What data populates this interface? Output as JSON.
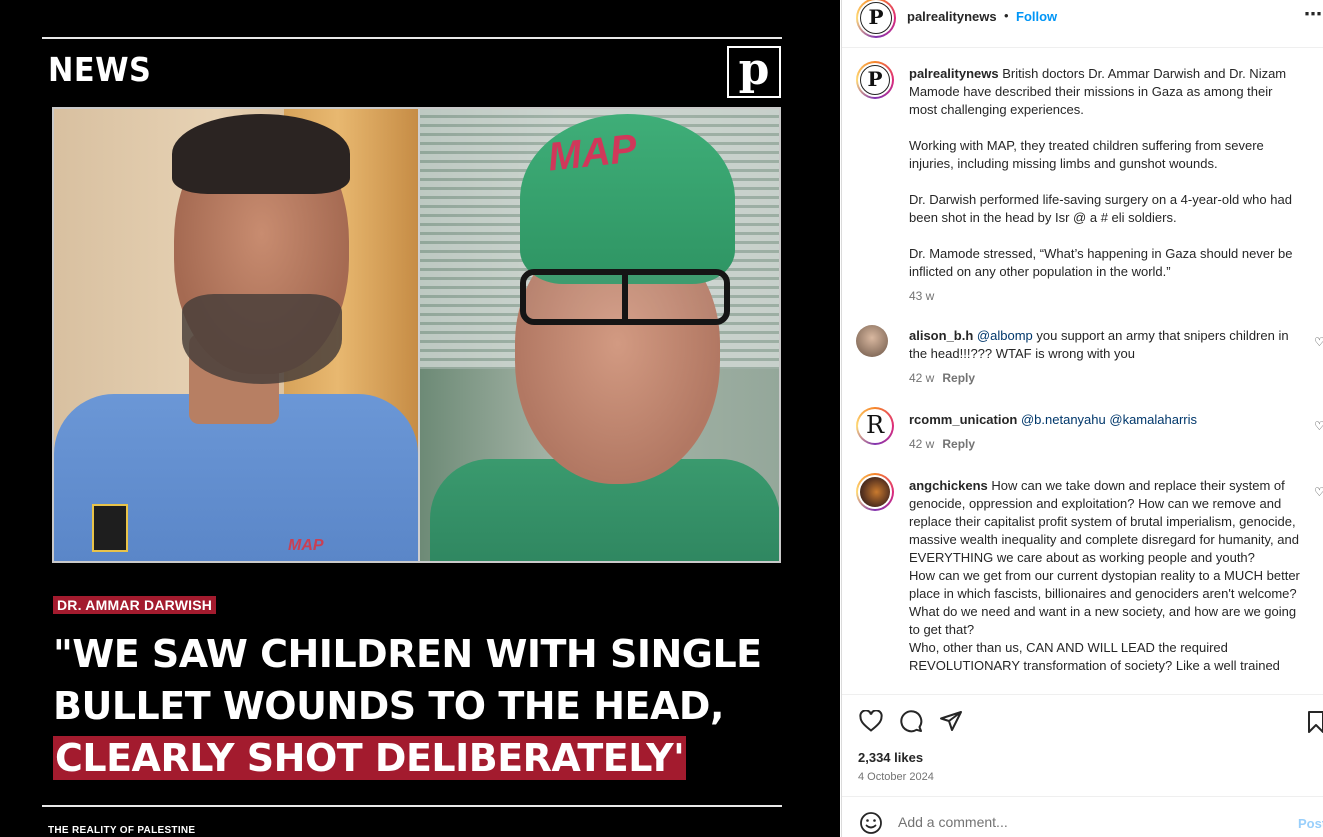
{
  "media": {
    "section_label": "NEWS",
    "brand_logo_letter": "p",
    "left_photo_badge": "MAP",
    "right_photo_cap": "MAP",
    "name_tag": "DR. AMMAR DARWISH",
    "quote_lines": [
      "\"WE SAW CHILDREN WITH SINGLE",
      "BULLET WOUNDS TO THE HEAD,",
      "CLEARLY SHOT DELIBERATELY'"
    ],
    "footer_brand": "THE REALITY OF  PALESTINE"
  },
  "header": {
    "avatar_letter": "P",
    "username": "palrealitynews",
    "separator": "•",
    "follow_label": "Follow",
    "more_icon": "more-horizontal-icon"
  },
  "caption": {
    "username": "palrealitynews",
    "paragraphs": [
      "British doctors Dr. Ammar Darwish and Dr. Nizam Mamode have described their missions in Gaza as among their most challenging experiences.",
      "Working with MAP, they treated children suffering from severe injuries, including missing limbs and gunshot wounds.",
      "Dr. Darwish performed life-saving surgery on a 4-year-old who had been shot in the head by Isr @ a # eli soldiers.",
      "Dr. Mamode stressed, “What’s happening in Gaza should never be inflicted on any other population in the world.”"
    ],
    "time": "43 w"
  },
  "comments": [
    {
      "username": "alison_b.h",
      "mention": "@albomp",
      "text": " you support an army that snipers children in the head!!!??? WTAF is wrong with you",
      "time": "42 w",
      "reply_label": "Reply"
    },
    {
      "username": "rcomm_unication",
      "avatar_letter": "R",
      "mention": "@b.netanyahu",
      "mention2": "@kamalaharris",
      "text": "",
      "time": "42 w",
      "reply_label": "Reply"
    },
    {
      "username": "angchickens",
      "text": " How can we take down and replace their system of genocide, oppression and exploitation? How can we remove and replace their capitalist profit system of brutal imperialism, genocide, massive wealth inequality and complete disregard for humanity, and EVERYTHING we care about as working people and youth?",
      "text2": "How can we get from our current dystopian reality to a MUCH better place in which fascists, billionaires and genociders aren't welcome? What do we need and want in a new society, and how are we going to get that?",
      "text3": "Who, other than us, CAN AND WILL LEAD the required REVOLUTIONARY transformation of society? Like a well trained"
    }
  ],
  "actions": {
    "icons": [
      "heart-icon",
      "comment-icon",
      "share-icon",
      "bookmark-icon"
    ],
    "likes": "2,334 likes",
    "date": "4 October 2024"
  },
  "add_comment": {
    "placeholder": "Add a comment...",
    "post_label": "Post"
  },
  "colors": {
    "accent": "#0095f6",
    "quote_highlight": "#a31b2e",
    "mention": "#00376b"
  }
}
